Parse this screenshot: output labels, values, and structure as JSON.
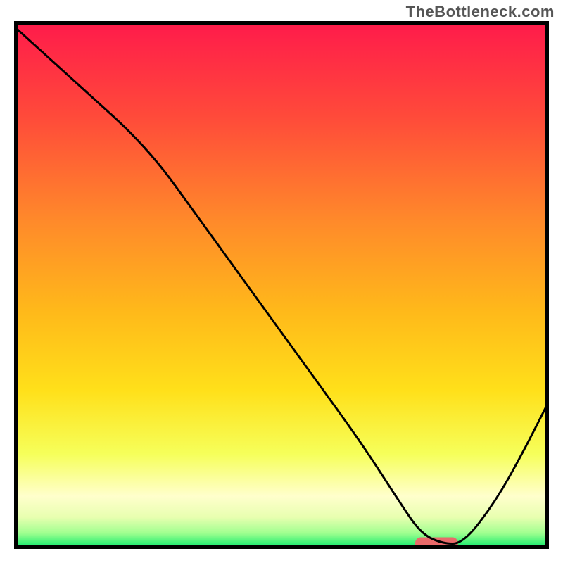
{
  "watermark": "TheBottleneck.com",
  "chart_data": {
    "type": "line",
    "title": "",
    "xlabel": "",
    "ylabel": "",
    "xlim": [
      0,
      100
    ],
    "ylim": [
      0,
      100
    ],
    "grid": false,
    "legend": null,
    "gradient_colors": {
      "top": "#ff1a4b",
      "upper_mid": "#ff8a2a",
      "mid": "#ffd400",
      "lower_mid": "#f6ff5a",
      "pale": "#ffffcc",
      "green": "#00e868"
    },
    "series": [
      {
        "name": "bottleneck-curve",
        "x": [
          0,
          12,
          25,
          35,
          45,
          55,
          65,
          72,
          76,
          80,
          84,
          90,
          95,
          100
        ],
        "y": [
          99,
          88,
          76,
          62,
          48,
          34,
          20,
          9,
          3,
          1,
          1,
          9,
          18,
          28
        ]
      }
    ],
    "marker": {
      "name": "optimal-range",
      "x_center": 79,
      "y": 1,
      "width_pct": 8,
      "color": "#e96a6a"
    }
  }
}
